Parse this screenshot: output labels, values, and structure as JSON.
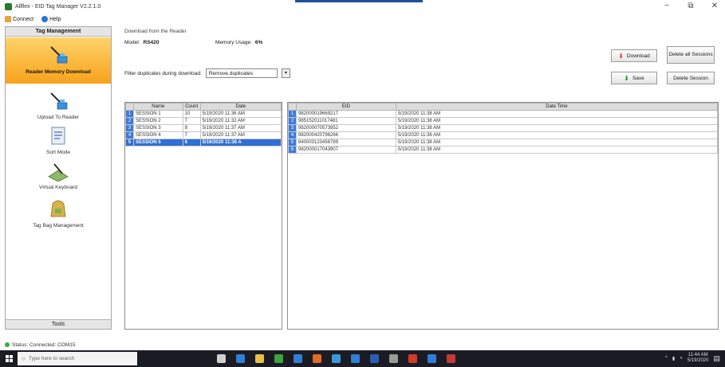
{
  "window": {
    "title": "Allflex - EID Tag Manager V2.2.1.0",
    "controls": [
      "−",
      "⧉",
      "✕"
    ]
  },
  "menu": [
    {
      "label": "Connect",
      "icon": "connect-icon"
    },
    {
      "label": "Help",
      "icon": "help-icon"
    }
  ],
  "sidebar": {
    "header": "Tag Management",
    "footer": "Tools",
    "items": [
      {
        "label": "Reader Memory Download",
        "icon": "reader-download-icon",
        "active": true
      },
      {
        "label": "Upload To Reader",
        "icon": "upload-reader-icon",
        "active": false
      },
      {
        "label": "Sort Mode",
        "icon": "sort-mode-icon",
        "active": false
      },
      {
        "label": "Virtual Keyboard",
        "icon": "virtual-keyboard-icon",
        "active": false
      },
      {
        "label": "Tag Bag Management",
        "icon": "tag-bag-icon",
        "active": false
      }
    ]
  },
  "download": {
    "section_title": "Download from the Reader",
    "model_label": "Model:",
    "model_value": "RS420",
    "memory_label": "Memory Usage:",
    "memory_value": "6%",
    "filter_label": "Filter duplicates during download:",
    "filter_value": "Remove duplicates"
  },
  "buttons": {
    "download": "Download",
    "delete_all": "Delete all Sessions",
    "save": "Save",
    "delete_session": "Delete Session"
  },
  "sessions": {
    "columns": [
      "Name",
      "Count",
      "Date"
    ],
    "rows": [
      [
        "1",
        "SESSION 1",
        "10",
        "5/19/2020 11:36 AM"
      ],
      [
        "2",
        "SESSION 2",
        "7",
        "5/19/2020 11:32 AM"
      ],
      [
        "3",
        "SESSION 3",
        "8",
        "5/19/2020 11:37 AM"
      ],
      [
        "4",
        "SESSION 4",
        "7",
        "5/19/2020 11:37 AM"
      ],
      [
        "5",
        "SESSION 5",
        "6",
        "5/19/2020 11:38 A"
      ]
    ],
    "selected_index": 4
  },
  "tags": {
    "columns": [
      "EID",
      "Date Time"
    ],
    "rows": [
      [
        "1",
        "982000019669217",
        "5/19/2020 11:38 AM"
      ],
      [
        "2",
        "985152011017481",
        "5/19/2020 11:38 AM"
      ],
      [
        "3",
        "982000070573952",
        "5/19/2020 11:38 AM"
      ],
      [
        "4",
        "982000420796266",
        "5/19/2020 11:38 AM"
      ],
      [
        "5",
        "840003123456789",
        "5/19/2020 11:38 AM"
      ],
      [
        "6",
        "982000017043907",
        "5/19/2020 11:38 AM"
      ]
    ]
  },
  "status": {
    "text": "Status: Connected: COM15"
  },
  "taskbar": {
    "search_placeholder": "Type here to search",
    "clock_time": "11:44 AM",
    "clock_date": "5/19/2020",
    "icons": [
      "task-view-icon",
      "edge-icon",
      "file-explorer-icon",
      "store-icon",
      "bluetooth-icon",
      "firefox-icon",
      "app-icon",
      "photos-icon",
      "word-icon",
      "settings-icon",
      "acrobat-icon",
      "outlook-icon",
      "allflex-icon"
    ]
  },
  "colors": {
    "accent": "#f7a21b",
    "selection": "#2f6fd6",
    "row_header": "#3c7bd9"
  }
}
